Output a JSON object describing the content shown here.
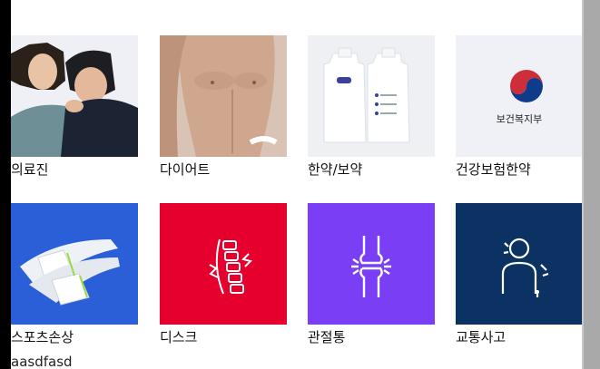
{
  "grid": {
    "items": [
      {
        "label": "의료진",
        "image": "staff-photo"
      },
      {
        "label": "다이어트",
        "image": "torso-photo"
      },
      {
        "label": "한약/보약",
        "image": "pouch-photo"
      },
      {
        "label": "건강보험한약",
        "image": "mohw-logo",
        "logo_text": "보건복지부"
      },
      {
        "label": "스포츠손상",
        "image": "ultrasound-probe-icon"
      },
      {
        "label": "디스크",
        "image": "spine-icon"
      },
      {
        "label": "관절통",
        "image": "knee-joint-icon"
      },
      {
        "label": "교통사고",
        "image": "injured-body-icon"
      }
    ]
  },
  "footer": {
    "text": "aasdfasd"
  },
  "colors": {
    "sports_bg": "#2b5fd8",
    "disc_bg": "#e6002d",
    "joint_bg": "#7a3ff5",
    "accident_bg": "#0b3263"
  }
}
